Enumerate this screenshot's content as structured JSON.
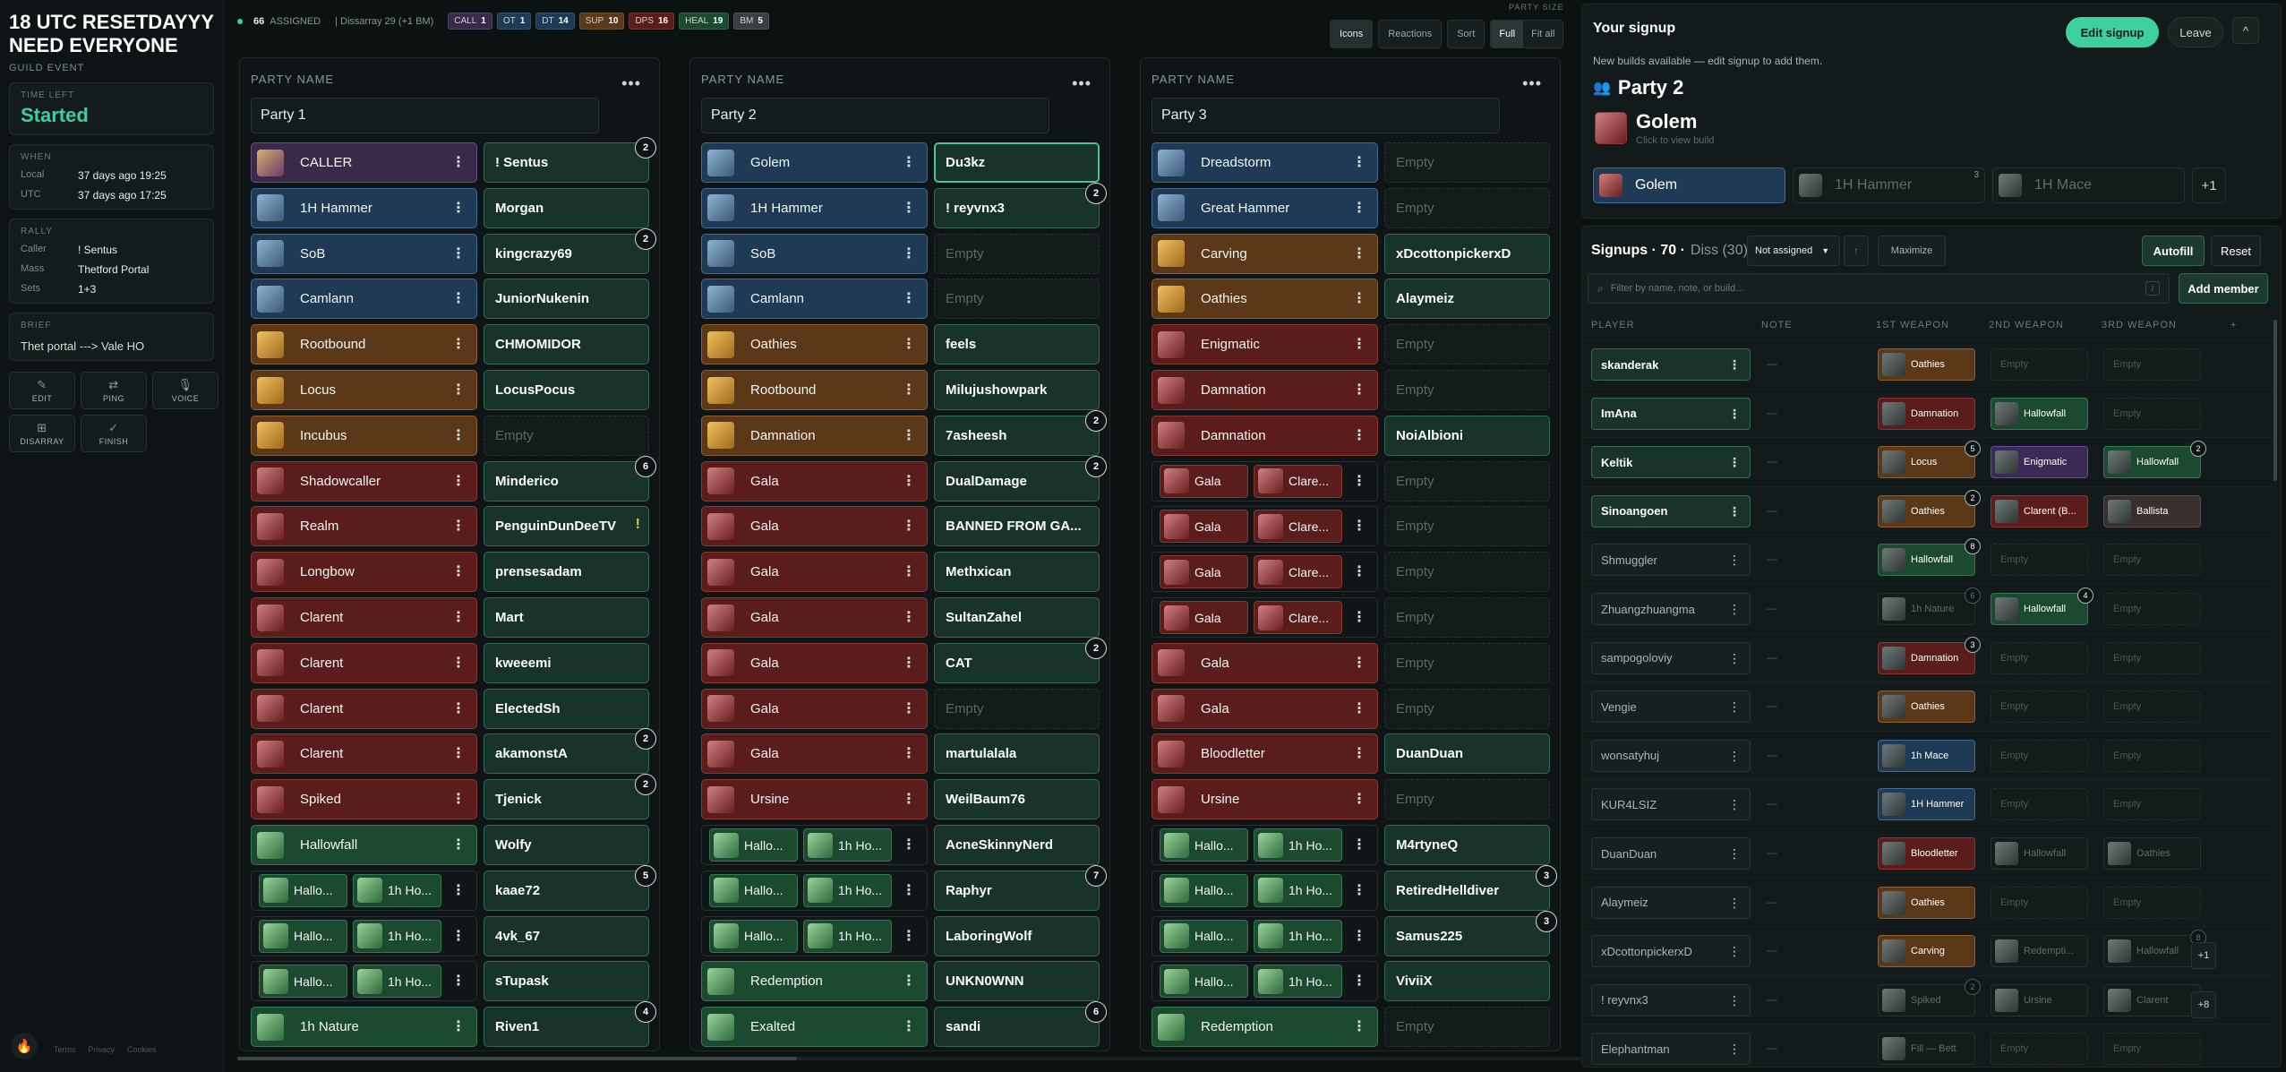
{
  "event": {
    "title": "18 UTC RESETDAYYY NEED EVERYONE",
    "subtitle": "GUILD EVENT",
    "time_left_label": "TIME LEFT",
    "status": "Started",
    "when_label": "WHEN",
    "local_label": "Local",
    "local_value": "37 days ago 19:25",
    "utc_label": "UTC",
    "utc_value": "37 days ago 17:25",
    "rally_label": "RALLY",
    "caller_label": "Caller",
    "caller_value": "! Sentus",
    "mass_label": "Mass",
    "mass_value": "Thetford Portal",
    "sets_label": "Sets",
    "sets_value": "1+3",
    "brief_label": "BRIEF",
    "brief_value": "Thet portal ---> Vale HO",
    "actions": [
      {
        "label": "EDIT",
        "icon": "pencil-icon",
        "glyph": "✎"
      },
      {
        "label": "PING",
        "icon": "ping-icon",
        "glyph": "⇄"
      },
      {
        "label": "VOICE",
        "icon": "mic-icon",
        "glyph": "🎙"
      },
      {
        "label": "DISARRAY",
        "icon": "grid-icon",
        "glyph": "⊞"
      },
      {
        "label": "FINISH",
        "icon": "check-circle-icon",
        "glyph": "✓"
      }
    ],
    "footer": [
      "Terms",
      "Privacy",
      "Cookies"
    ]
  },
  "topbar": {
    "assigned_count": "66",
    "assigned_label": "ASSIGNED",
    "disarray": "| Dissarray 29 (+1 BM)",
    "chips": [
      {
        "label": "CALL",
        "value": "1",
        "color": "#3a2a4a"
      },
      {
        "label": "OT",
        "value": "1",
        "color": "#1e3a55"
      },
      {
        "label": "DT",
        "value": "14",
        "color": "#1e3a55"
      },
      {
        "label": "SUP",
        "value": "10",
        "color": "#5a3818"
      },
      {
        "label": "DPS",
        "value": "16",
        "color": "#5a1d1b"
      },
      {
        "label": "HEAL",
        "value": "19",
        "color": "#1c4a30"
      },
      {
        "label": "BM",
        "value": "5",
        "color": "#3a3f42"
      }
    ],
    "party_size_label": "PARTY SIZE",
    "btn_icons": "Icons",
    "btn_reactions": "Reactions",
    "btn_sort": "Sort",
    "btn_full": "Full",
    "btn_fitall": "Fit all"
  },
  "party_header_label": "PARTY NAME",
  "parties": [
    {
      "name": "Party 1",
      "rows": [
        {
          "role": "CALLER",
          "cls": "call",
          "player": "! Sentus",
          "badge": "2"
        },
        {
          "role": "1H Hammer",
          "cls": "tank",
          "player": "Morgan"
        },
        {
          "role": "SoB",
          "cls": "tank",
          "player": "kingcrazy69",
          "badge": "2"
        },
        {
          "role": "Camlann",
          "cls": "tank",
          "player": "JuniorNukenin"
        },
        {
          "role": "Rootbound",
          "cls": "sup",
          "player": "CHMOMIDOR"
        },
        {
          "role": "Locus",
          "cls": "sup",
          "player": "LocusPocus"
        },
        {
          "role": "Incubus",
          "cls": "sup",
          "player": "Empty",
          "empty": true
        },
        {
          "role": "Shadowcaller",
          "cls": "dps",
          "player": "Minderico",
          "badge": "6"
        },
        {
          "role": "Realm",
          "cls": "dps",
          "player": "PenguinDunDeeTV",
          "warn": "!"
        },
        {
          "role": "Longbow",
          "cls": "dps",
          "player": "prensesadam"
        },
        {
          "role": "Clarent",
          "cls": "dps",
          "player": "Mart"
        },
        {
          "role": "Clarent",
          "cls": "dps",
          "player": "kweeemi"
        },
        {
          "role": "Clarent",
          "cls": "dps",
          "player": "ElectedSh"
        },
        {
          "role": "Clarent",
          "cls": "dps",
          "player": "akamonstA",
          "badge": "2"
        },
        {
          "role": "Spiked",
          "cls": "dps",
          "player": "Tjenick",
          "badge": "2"
        },
        {
          "role": "Hallowfall",
          "cls": "heal",
          "player": "Wolfy"
        },
        {
          "split": [
            "Hallo...",
            "1h Ho..."
          ],
          "cls": "heal",
          "player": "kaae72",
          "badge": "5"
        },
        {
          "split": [
            "Hallo...",
            "1h Ho..."
          ],
          "cls": "heal",
          "player": "4vk_67"
        },
        {
          "split": [
            "Hallo...",
            "1h Ho..."
          ],
          "cls": "heal",
          "player": "sTupask"
        },
        {
          "role": "1h Nature",
          "cls": "heal",
          "player": "Riven1",
          "badge": "4"
        }
      ]
    },
    {
      "name": "Party 2",
      "rows": [
        {
          "role": "Golem",
          "cls": "tank",
          "player": "Du3kz",
          "selected": true
        },
        {
          "role": "1H Hammer",
          "cls": "tank",
          "player": "! reyvnx3",
          "badge": "2"
        },
        {
          "role": "SoB",
          "cls": "tank",
          "player": "Empty",
          "empty": true
        },
        {
          "role": "Camlann",
          "cls": "tank",
          "player": "Empty",
          "empty": true
        },
        {
          "role": "Oathies",
          "cls": "sup",
          "player": "feels"
        },
        {
          "role": "Rootbound",
          "cls": "sup",
          "player": "Milujushowpark"
        },
        {
          "role": "Damnation",
          "cls": "sup",
          "player": "7asheesh",
          "badge": "2"
        },
        {
          "role": "Gala",
          "cls": "dps",
          "player": "DualDamage",
          "badge": "2"
        },
        {
          "role": "Gala",
          "cls": "dps",
          "player": "BANNED FROM GA..."
        },
        {
          "role": "Gala",
          "cls": "dps",
          "player": "Methxican"
        },
        {
          "role": "Gala",
          "cls": "dps",
          "player": "SultanZahel"
        },
        {
          "role": "Gala",
          "cls": "dps",
          "player": "CAT",
          "badge": "2"
        },
        {
          "role": "Gala",
          "cls": "dps",
          "player": "Empty",
          "empty": true
        },
        {
          "role": "Gala",
          "cls": "dps",
          "player": "martulalala"
        },
        {
          "role": "Ursine",
          "cls": "dps",
          "player": "WeilBaum76"
        },
        {
          "split": [
            "Hallo...",
            "1h Ho..."
          ],
          "cls": "heal",
          "player": "AcneSkinnyNerd"
        },
        {
          "split": [
            "Hallo...",
            "1h Ho..."
          ],
          "cls": "heal",
          "player": "Raphyr",
          "badge": "7"
        },
        {
          "split": [
            "Hallo...",
            "1h Ho..."
          ],
          "cls": "heal",
          "player": "LaboringWolf"
        },
        {
          "role": "Redemption",
          "cls": "heal",
          "player": "UNKN0WNN"
        },
        {
          "role": "Exalted",
          "cls": "heal",
          "player": "sandi",
          "badge": "6"
        }
      ]
    },
    {
      "name": "Party 3",
      "rows": [
        {
          "role": "Dreadstorm",
          "cls": "tank",
          "player": "Empty",
          "empty": true
        },
        {
          "role": "Great Hammer",
          "cls": "tank",
          "player": "Empty",
          "empty": true
        },
        {
          "role": "Carving",
          "cls": "sup",
          "player": "xDcottonpickerxD"
        },
        {
          "role": "Oathies",
          "cls": "sup",
          "player": "Alaymeiz"
        },
        {
          "role": "Enigmatic",
          "cls": "dps",
          "player": "Empty",
          "empty": true
        },
        {
          "role": "Damnation",
          "cls": "dps",
          "player": "Empty",
          "empty": true
        },
        {
          "role": "Damnation",
          "cls": "dps",
          "player": "NoiAlbioni"
        },
        {
          "split": [
            "Gala",
            "Clare..."
          ],
          "cls": "dps",
          "player": "Empty",
          "empty": true
        },
        {
          "split": [
            "Gala",
            "Clare..."
          ],
          "cls": "dps",
          "player": "Empty",
          "empty": true
        },
        {
          "split": [
            "Gala",
            "Clare..."
          ],
          "cls": "dps",
          "player": "Empty",
          "empty": true
        },
        {
          "split": [
            "Gala",
            "Clare..."
          ],
          "cls": "dps",
          "player": "Empty",
          "empty": true
        },
        {
          "role": "Gala",
          "cls": "dps",
          "player": "Empty",
          "empty": true
        },
        {
          "role": "Gala",
          "cls": "dps",
          "player": "Empty",
          "empty": true
        },
        {
          "role": "Bloodletter",
          "cls": "dps",
          "player": "DuanDuan"
        },
        {
          "role": "Ursine",
          "cls": "dps",
          "player": "Empty",
          "empty": true
        },
        {
          "split": [
            "Hallo...",
            "1h Ho..."
          ],
          "cls": "heal",
          "player": "M4rtyneQ"
        },
        {
          "split": [
            "Hallo...",
            "1h Ho..."
          ],
          "cls": "heal",
          "player": "RetiredHelldiver",
          "badge": "3"
        },
        {
          "split": [
            "Hallo...",
            "1h Ho..."
          ],
          "cls": "heal",
          "player": "Samus225",
          "badge": "3"
        },
        {
          "split": [
            "Hallo...",
            "1h Ho..."
          ],
          "cls": "heal",
          "player": "ViviiX"
        },
        {
          "role": "Redemption",
          "cls": "heal",
          "player": "Empty",
          "empty": true
        }
      ]
    }
  ],
  "signup": {
    "title": "Your signup",
    "edit_btn": "Edit signup",
    "leave_btn": "Leave",
    "collapse_glyph": "^",
    "note": "New builds available — edit signup to add them.",
    "party": "Party 2",
    "build": "Golem",
    "build_hint": "Click to view build",
    "weapons": [
      {
        "label": "Golem",
        "active": true
      },
      {
        "label": "1H Hammer",
        "count": "3"
      },
      {
        "label": "1H Mace"
      }
    ],
    "more": "+1"
  },
  "signups": {
    "title": "Signups · 70 ·",
    "diss": "Diss (30)",
    "filter": "Not assigned",
    "sort_glyph": "↑",
    "maximize": "Maximize",
    "autofill": "Autofill",
    "reset": "Reset",
    "search_placeholder": "Filter by name, note, or build...",
    "search_kbd": "/",
    "add_member": "Add member",
    "columns": [
      "PLAYER",
      "NOTE",
      "1ST WEAPON",
      "2ND WEAPON",
      "3RD WEAPON",
      "+"
    ],
    "rows": [
      {
        "player": "skanderak",
        "green": true,
        "w": [
          {
            "t": "Oathies",
            "c": "sup"
          },
          {
            "t": "Empty",
            "c": "e"
          },
          {
            "t": "Empty",
            "c": "e"
          }
        ]
      },
      {
        "player": "ImAna",
        "green": true,
        "w": [
          {
            "t": "Damnation",
            "c": "dps"
          },
          {
            "t": "Hallowfall",
            "c": "heal"
          },
          {
            "t": "Empty",
            "c": "e"
          }
        ]
      },
      {
        "player": "Keltik",
        "green": true,
        "w": [
          {
            "t": "Locus",
            "c": "sup",
            "b": "5"
          },
          {
            "t": "Enigmatic",
            "c": "bm"
          },
          {
            "t": "Hallowfall",
            "c": "heal",
            "b": "2"
          }
        ]
      },
      {
        "player": "Sinoangoen",
        "green": true,
        "w": [
          {
            "t": "Oathies",
            "c": "sup",
            "b": "2"
          },
          {
            "t": "Clarent (B...",
            "c": "dps"
          },
          {
            "t": "Ballista",
            "c": "bal"
          }
        ]
      },
      {
        "player": "Shmuggler",
        "w": [
          {
            "t": "Hallowfall",
            "c": "heal",
            "b": "8"
          },
          {
            "t": "Empty",
            "c": "e"
          },
          {
            "t": "Empty",
            "c": "e"
          }
        ]
      },
      {
        "player": "Zhuangzhuangma",
        "w": [
          {
            "t": "1h Nature",
            "c": "dim",
            "b": "6",
            "bd": true
          },
          {
            "t": "Hallowfall",
            "c": "heal",
            "b": "4"
          },
          {
            "t": "Empty",
            "c": "e"
          }
        ]
      },
      {
        "player": "sampogoloviy",
        "w": [
          {
            "t": "Damnation",
            "c": "dps",
            "b": "3"
          },
          {
            "t": "Empty",
            "c": "e"
          },
          {
            "t": "Empty",
            "c": "e"
          }
        ]
      },
      {
        "player": "Vengie",
        "w": [
          {
            "t": "Oathies",
            "c": "sup"
          },
          {
            "t": "Empty",
            "c": "e"
          },
          {
            "t": "Empty",
            "c": "e"
          }
        ]
      },
      {
        "player": "wonsatyhuj",
        "w": [
          {
            "t": "1h Mace",
            "c": "tank"
          },
          {
            "t": "Empty",
            "c": "e"
          },
          {
            "t": "Empty",
            "c": "e"
          }
        ]
      },
      {
        "player": "KUR4LSIZ",
        "w": [
          {
            "t": "1H Hammer",
            "c": "tank"
          },
          {
            "t": "Empty",
            "c": "e"
          },
          {
            "t": "Empty",
            "c": "e"
          }
        ]
      },
      {
        "player": "DuanDuan",
        "w": [
          {
            "t": "Bloodletter",
            "c": "dps"
          },
          {
            "t": "Hallowfall",
            "c": "dim"
          },
          {
            "t": "Oathies",
            "c": "dim"
          }
        ]
      },
      {
        "player": "Alaymeiz",
        "w": [
          {
            "t": "Oathies",
            "c": "sup"
          },
          {
            "t": "Empty",
            "c": "e"
          },
          {
            "t": "Empty",
            "c": "e"
          }
        ]
      },
      {
        "player": "xDcottonpickerxD",
        "w": [
          {
            "t": "Carving",
            "c": "sup"
          },
          {
            "t": "Redempti...",
            "c": "dim"
          },
          {
            "t": "Hallowfall",
            "c": "dim",
            "b": "8",
            "bd": true
          }
        ],
        "plus": "+1"
      },
      {
        "player": "! reyvnx3",
        "w": [
          {
            "t": "Spiked",
            "c": "dim",
            "b": "2",
            "bd": true
          },
          {
            "t": "Ursine",
            "c": "dim"
          },
          {
            "t": "Clarent",
            "c": "dim"
          }
        ],
        "plus": "+8"
      },
      {
        "player": "Elephantman",
        "w": [
          {
            "t": "Fill — Bett",
            "c": "dim"
          },
          {
            "t": "Empty",
            "c": "e"
          },
          {
            "t": "Empty",
            "c": "e"
          }
        ]
      }
    ]
  }
}
